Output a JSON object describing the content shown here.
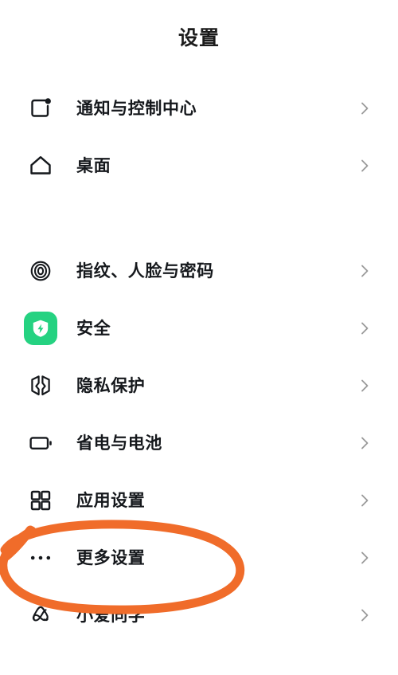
{
  "header": {
    "title": "设置"
  },
  "colors": {
    "background": "#ffffff",
    "text": "#15181c",
    "chevron": "#9a9a9a",
    "security_tile": "#25d281",
    "annotation": "#f06c2a"
  },
  "list": {
    "groups": [
      {
        "items": [
          {
            "label": "通知与控制中心",
            "icon": "notification-square-dot-icon",
            "chevron": "chevron-right-icon",
            "icon_style": "outline"
          },
          {
            "label": "桌面",
            "icon": "home-icon",
            "chevron": "chevron-right-icon",
            "icon_style": "outline"
          }
        ]
      },
      {
        "items": [
          {
            "label": "指纹、人脸与密码",
            "icon": "fingerprint-icon",
            "chevron": "chevron-right-icon",
            "icon_style": "outline"
          },
          {
            "label": "安全",
            "icon": "security-shield-bolt-icon",
            "chevron": "chevron-right-icon",
            "icon_style": "tile",
            "tile_color": "#25d281"
          },
          {
            "label": "隐私保护",
            "icon": "privacy-shield-icon",
            "chevron": "chevron-right-icon",
            "icon_style": "outline"
          },
          {
            "label": "省电与电池",
            "icon": "battery-icon",
            "chevron": "chevron-right-icon",
            "icon_style": "outline"
          },
          {
            "label": "应用设置",
            "icon": "app-grid-icon",
            "chevron": "chevron-right-icon",
            "icon_style": "outline"
          },
          {
            "label": "更多设置",
            "icon": "more-ellipsis-icon",
            "chevron": "chevron-right-icon",
            "icon_style": "outline",
            "highlighted": true
          },
          {
            "label": "小爱同学",
            "icon": "xiaoai-logo-icon",
            "chevron": "chevron-right-icon",
            "icon_style": "outline"
          }
        ]
      }
    ]
  },
  "annotation": {
    "type": "hand-drawn-ellipse",
    "target_label": "更多设置",
    "color": "#f06c2a",
    "stroke_width": 11
  }
}
